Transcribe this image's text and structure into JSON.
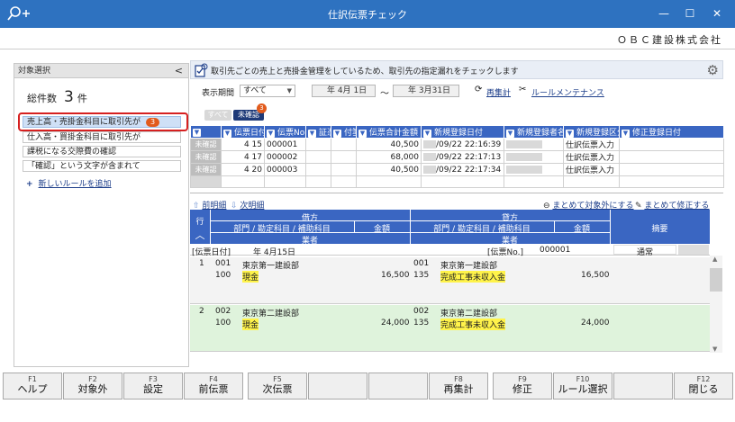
{
  "window": {
    "title": "仕訳伝票チェック",
    "company": "ＯＢＣ建設株式会社",
    "minimize": "—",
    "maximize": "☐",
    "close": "✕"
  },
  "left": {
    "header": "対象選択",
    "collapse": "<",
    "total_label": "総件数",
    "total_value": "3",
    "total_unit": "件",
    "rules": [
      {
        "label": "売上高・売掛金科目に取引先が",
        "badge": "3"
      },
      {
        "label": "仕入高・買掛金科目に取引先が"
      },
      {
        "label": "課税になる交際費の確認"
      },
      {
        "label": "「確認」という文字が含まれて"
      }
    ],
    "add_rule_plus": "+",
    "add_rule": "新しいルールを追加"
  },
  "info": {
    "text": "取引先ごとの売上と売掛金管理をしているため、取引先の指定漏れをチェックします"
  },
  "period": {
    "label": "表示期間",
    "select": "すべて",
    "from": "年 4月 1日",
    "to": "年 3月31日",
    "tilde": "〜",
    "recalc": "再集計",
    "rule_maint": "ルールメンテナンス"
  },
  "filters": {
    "all": "すべて",
    "unconfirmed": "未確認",
    "unconfirmed_count": "3"
  },
  "voucher_table": {
    "columns": [
      "",
      "伝票日付",
      "伝票No.",
      "証憑",
      "付箋",
      "伝票合計金額",
      "新規登録日付",
      "新規登録者名",
      "新規登録区分",
      "修正登録日付"
    ],
    "rows": [
      {
        "status": "未確認",
        "date": "4 15",
        "no": "000001",
        "amount": "40,500",
        "reg": "/09/22 22:16:39",
        "kubun": "仕訳伝票入力"
      },
      {
        "status": "未確認",
        "date": "4 17",
        "no": "000002",
        "amount": "68,000",
        "reg": "/09/22 22:17:13",
        "kubun": "仕訳伝票入力"
      },
      {
        "status": "未確認",
        "date": "4 20",
        "no": "000003",
        "amount": "40,500",
        "reg": "/09/22 22:17:34",
        "kubun": "仕訳伝票入力"
      }
    ]
  },
  "detail": {
    "prev": "前明細",
    "next": "次明細",
    "exclude_all": "まとめて対象外にする",
    "edit_all": "まとめて修正する",
    "head": {
      "row": "行",
      "debit": "借方",
      "credit": "貸方",
      "dept": "部門 / 勘定科目 / 補助科目",
      "amount": "金額",
      "vendor": "業者",
      "memo": "摘要"
    },
    "voucher_date_label": "[伝票日付]",
    "voucher_date": "年 4月15日",
    "voucher_no_label": "[伝票No.]",
    "voucher_no": "000001",
    "kind": "通常",
    "entries": [
      {
        "line": "1",
        "d_code": "001",
        "d_dept": "東京第一建設部",
        "d_acct_code": "100",
        "d_acct": "現金",
        "d_amount": "16,500",
        "c_code": "001",
        "c_dept": "東京第一建設部",
        "c_acct_code": "135",
        "c_acct": "完成工事未収入金",
        "c_amount": "16,500"
      },
      {
        "line": "2",
        "d_code": "002",
        "d_dept": "東京第二建設部",
        "d_acct_code": "100",
        "d_acct": "現金",
        "d_amount": "24,000",
        "c_code": "002",
        "c_dept": "東京第二建設部",
        "c_acct_code": "135",
        "c_acct": "完成工事未収入金",
        "c_amount": "24,000"
      }
    ]
  },
  "fkeys": [
    {
      "n": "F1",
      "l": "ヘルプ"
    },
    {
      "n": "F2",
      "l": "対象外"
    },
    {
      "n": "F3",
      "l": "設定"
    },
    {
      "n": "F4",
      "l": "前伝票"
    },
    {
      "n": "F5",
      "l": "次伝票"
    },
    {
      "n": "",
      "l": ""
    },
    {
      "n": "",
      "l": ""
    },
    {
      "n": "F8",
      "l": "再集計"
    },
    {
      "n": "F9",
      "l": "修正"
    },
    {
      "n": "F10",
      "l": "ルール選択"
    },
    {
      "n": "",
      "l": ""
    },
    {
      "n": "F12",
      "l": "閉じる"
    }
  ]
}
